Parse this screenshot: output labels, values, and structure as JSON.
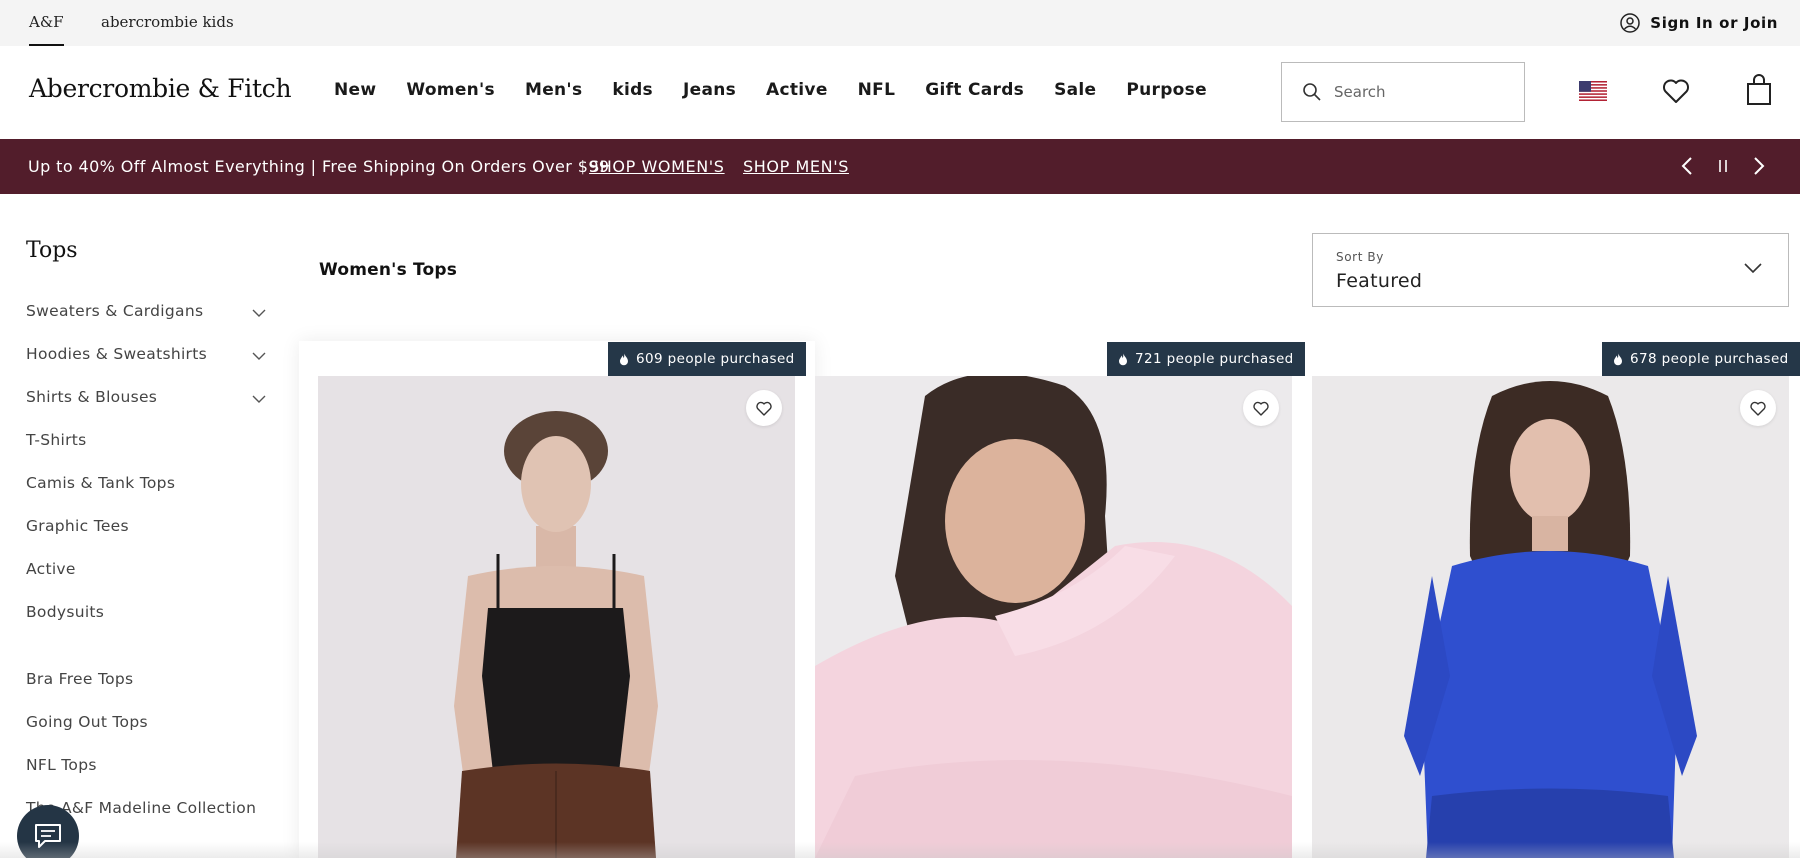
{
  "util_bar": {
    "tabs": [
      "A&F",
      "abercrombie kids"
    ],
    "signin_label": "Sign In or Join"
  },
  "header": {
    "logo": "Abercrombie & Fitch",
    "nav": [
      "New",
      "Women's",
      "Men's",
      "kids",
      "Jeans",
      "Active",
      "NFL",
      "Gift Cards",
      "Sale",
      "Purpose"
    ],
    "search_placeholder": "Search",
    "icons": [
      "us-flag-icon",
      "heart-icon",
      "shopping-bag-icon"
    ]
  },
  "promo": {
    "text": "Up to 40% Off Almost Everything | Free Shipping On Orders Over $99",
    "links": [
      "SHOP WOMEN'S",
      "SHOP MEN'S"
    ],
    "background": "#521d2b"
  },
  "sidebar": {
    "title": "Tops",
    "categories": [
      {
        "label": "Sweaters & Cardigans",
        "expandable": true
      },
      {
        "label": "Hoodies & Sweatshirts",
        "expandable": true
      },
      {
        "label": "Shirts & Blouses",
        "expandable": true
      },
      {
        "label": "T-Shirts",
        "expandable": false
      },
      {
        "label": "Camis & Tank Tops",
        "expandable": false
      },
      {
        "label": "Graphic Tees",
        "expandable": false
      },
      {
        "label": "Active",
        "expandable": false
      },
      {
        "label": "Bodysuits",
        "expandable": false
      },
      {
        "label": "Bra Free Tops",
        "expandable": false
      },
      {
        "label": "Going Out Tops",
        "expandable": false
      },
      {
        "label": "NFL Tops",
        "expandable": false
      },
      {
        "label": "The A&F Madeline Collection",
        "expandable": false
      }
    ]
  },
  "main": {
    "heading": "Women's Tops",
    "sort": {
      "label": "Sort By",
      "value": "Featured"
    }
  },
  "products": [
    {
      "badge": "609 people purchased",
      "image": "woman-black-cami-brown-pants"
    },
    {
      "badge": "721 people purchased",
      "image": "woman-pink-long-sleeve-top"
    },
    {
      "badge": "678 people purchased",
      "image": "woman-blue-long-sleeve-tee"
    }
  ],
  "colors": {
    "badge_bg": "#253748",
    "chat_bg": "#243545"
  }
}
